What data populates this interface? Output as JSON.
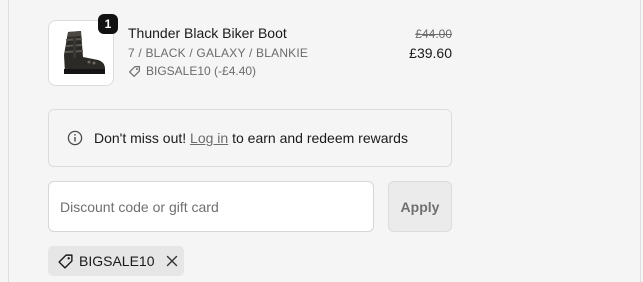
{
  "order": {
    "item": {
      "image_icon": "biker-boot-image",
      "quantity": "1",
      "name": "Thunder Black Biker Boot",
      "variant": "7 / BLACK / GALAXY / BLANKIE",
      "discount_label": "BIGSALE10 (-£4.40)",
      "original_price": "£44.00",
      "sale_price": "£39.60"
    },
    "rewards_notice": {
      "icon": "info-icon",
      "prefix": "Don't miss out!",
      "link_text": "Log in",
      "suffix": "to earn and redeem rewards"
    },
    "discount": {
      "placeholder": "Discount code or gift card",
      "value": "",
      "apply_label": "Apply"
    },
    "applied_codes": [
      {
        "code": "BIGSALE10",
        "icon": "tag-icon",
        "remove_icon": "close-icon"
      }
    ]
  },
  "colors": {
    "background": "#f5f5f5",
    "text": "#1a1a1a",
    "muted_text": "#6b6b6b",
    "border": "#dcdcdc",
    "badge": "#111111",
    "chip": "#e6e6e6"
  }
}
